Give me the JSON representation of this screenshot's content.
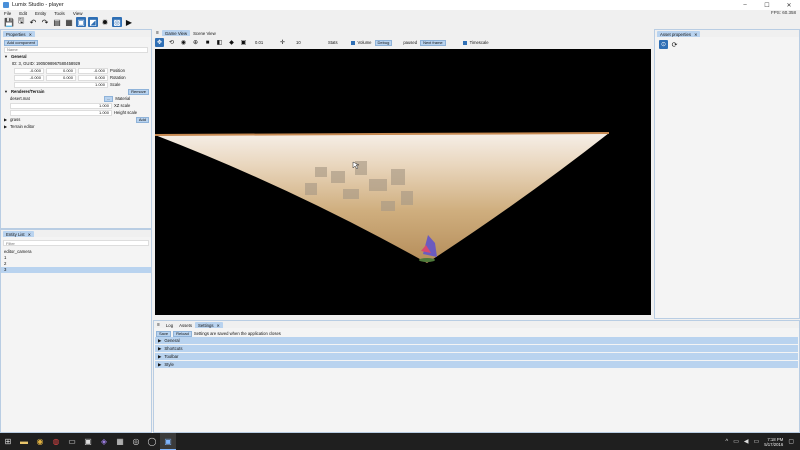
{
  "window": {
    "title": "Lumix Studio - player",
    "controls": [
      "–",
      "☐",
      "✕"
    ]
  },
  "menu": [
    "File",
    "Edit",
    "Entity",
    "Tools",
    "View"
  ],
  "fps": "FPS: 60.358",
  "toolbar_icons": [
    "save-icon",
    "save-as-icon",
    "undo-icon",
    "redo-icon",
    "copy-icon",
    "snap-icon",
    "local-coord-icon",
    "fire-icon",
    "grid-icon",
    "play-icon"
  ],
  "properties": {
    "tab": "Properties",
    "add_component": "Add component",
    "name_placeholder": "Name",
    "general_title": "General",
    "id_line": "ID: 3, GUID: 1905098967580458929",
    "position": {
      "x": "-0.000",
      "y": "0.000",
      "z": "-0.000",
      "label": "Position"
    },
    "rotation": {
      "x": "-0.000",
      "y": "0.000",
      "z": "0.000",
      "label": "Rotation"
    },
    "scale": {
      "value": "1.000",
      "label": "Scale"
    },
    "terrain_title": "Renderer/Terrain",
    "remove": "Remove",
    "material_value": "desert.mat",
    "material_btn": "...",
    "material_label": "Material",
    "xz_value": "1.000",
    "xz_label": "XZ scale",
    "height_value": "1.000",
    "height_label": "Height scale",
    "grass": "grass",
    "add": "Add",
    "terrain_editor": "Terrain editor"
  },
  "entity_list": {
    "tab": "Entity List",
    "filter_placeholder": "Filter",
    "items": [
      "editor_camera",
      "1",
      "2",
      "3"
    ]
  },
  "scene": {
    "tabs": [
      "Game View",
      "Scene View"
    ],
    "speed": "0.01",
    "grid": "10",
    "stats": "Stats",
    "volume": "Volume",
    "debug": "Debug",
    "paused": "paused",
    "next_frame": "Next frame",
    "timescale": "Timescale"
  },
  "asset_props": {
    "tab": "Asset properties"
  },
  "bottom": {
    "tabs": [
      "Log",
      "Assets",
      "Settings"
    ],
    "save": "Save",
    "reload": "Reload",
    "note": "Settings are saved when the application closes",
    "sections": [
      "General",
      "Shortcuts",
      "Toolbar",
      "Style"
    ]
  },
  "taskbar": {
    "time": "7:18 PM",
    "date": "5/17/2016"
  }
}
